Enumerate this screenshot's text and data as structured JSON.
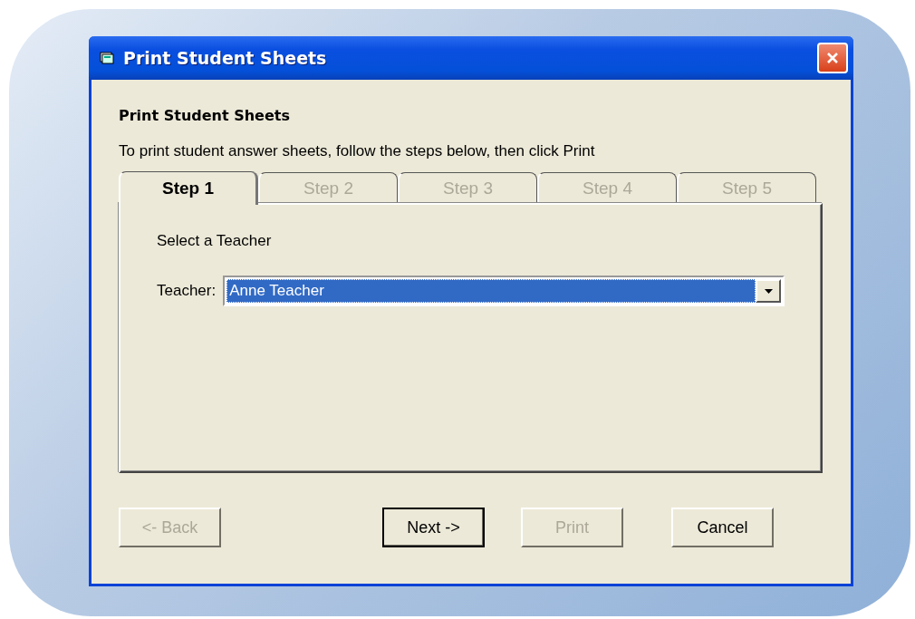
{
  "window": {
    "title": "Print Student Sheets"
  },
  "heading": "Print Student Sheets",
  "instructions": "To print student answer sheets, follow the steps below, then click Print",
  "tabs": [
    {
      "label": "Step 1",
      "selected": true
    },
    {
      "label": "Step 2",
      "selected": false
    },
    {
      "label": "Step 3",
      "selected": false
    },
    {
      "label": "Step 4",
      "selected": false
    },
    {
      "label": "Step 5",
      "selected": false
    }
  ],
  "panel": {
    "prompt": "Select a Teacher",
    "field_label": "Teacher:",
    "teacher": {
      "value": "Anne Teacher",
      "selected": true
    }
  },
  "buttons": [
    {
      "label": "<- Back",
      "disabled": true,
      "default": false
    },
    {
      "label": "Next ->",
      "disabled": false,
      "default": true
    },
    {
      "label": "Print",
      "disabled": true,
      "default": false
    },
    {
      "label": "Cancel",
      "disabled": false,
      "default": false
    }
  ]
}
